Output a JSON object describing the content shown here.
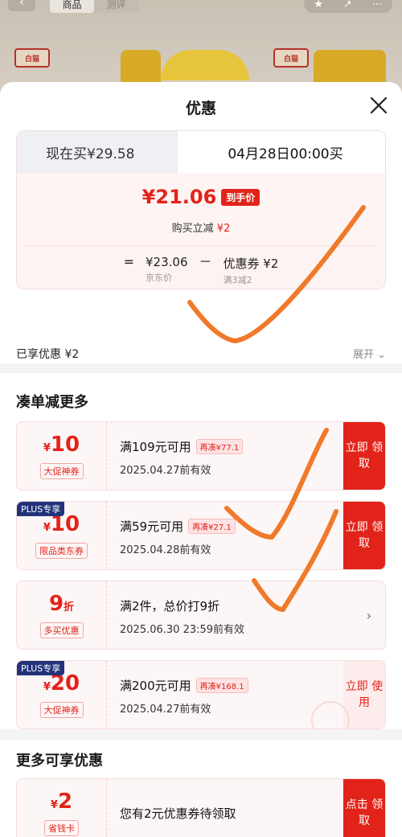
{
  "background": {
    "tabs": [
      "商品",
      "测评"
    ],
    "brand_logo_text": "白猫"
  },
  "sheet": {
    "title": "优惠"
  },
  "price": {
    "now_label": "现在买¥29.58",
    "later_label": "04月28日00:00买",
    "final_price": "¥21.06",
    "final_badge": "到手价",
    "reduce_text": "购买立减",
    "reduce_amount": "¥2",
    "eq": "=",
    "jd_price": "¥23.06",
    "jd_price_label": "京东价",
    "minus": "－",
    "coupon_value": "优惠券 ¥2",
    "coupon_rule": "满3减2",
    "enjoyed": "已享优惠 ¥2",
    "expand": "展开"
  },
  "section1": {
    "title": "凑单减更多",
    "coupons": [
      {
        "plus": "",
        "currency": "¥",
        "amount": "10",
        "unit": "",
        "tag": "大促神券",
        "condition": "满109元可用",
        "extra": "再凑¥77.1",
        "valid": "2025.04.27前有效",
        "action": "立即 领取",
        "action_type": "primary"
      },
      {
        "plus": "PLUS专享",
        "currency": "¥",
        "amount": "10",
        "unit": "",
        "tag": "限品类东券",
        "condition": "满59元可用",
        "extra": "再凑¥27.1",
        "valid": "2025.04.28前有效",
        "action": "立即 领取",
        "action_type": "primary"
      },
      {
        "plus": "",
        "currency": "",
        "amount": "9",
        "unit": "折",
        "tag": "多买优惠",
        "condition": "满2件，总价打9折",
        "extra": "",
        "valid": "2025.06.30 23:59前有效",
        "action": "›",
        "action_type": "arrow"
      },
      {
        "plus": "PLUS专享",
        "currency": "¥",
        "amount": "20",
        "unit": "",
        "tag": "大促神券",
        "condition": "满200元可用",
        "extra": "再凑¥168.1",
        "valid": "2025.04.27前有效",
        "action": "立即 使用",
        "action_type": "light"
      }
    ]
  },
  "section2": {
    "title": "更多可享优惠",
    "coupon": {
      "currency": "¥",
      "amount": "2",
      "tag": "省钱卡",
      "condition": "您有2元优惠券待领取",
      "action": "点击 领取"
    }
  },
  "colors": {
    "accent": "#e2231a",
    "plus": "#22337a",
    "annotation": "#f07a2a"
  }
}
